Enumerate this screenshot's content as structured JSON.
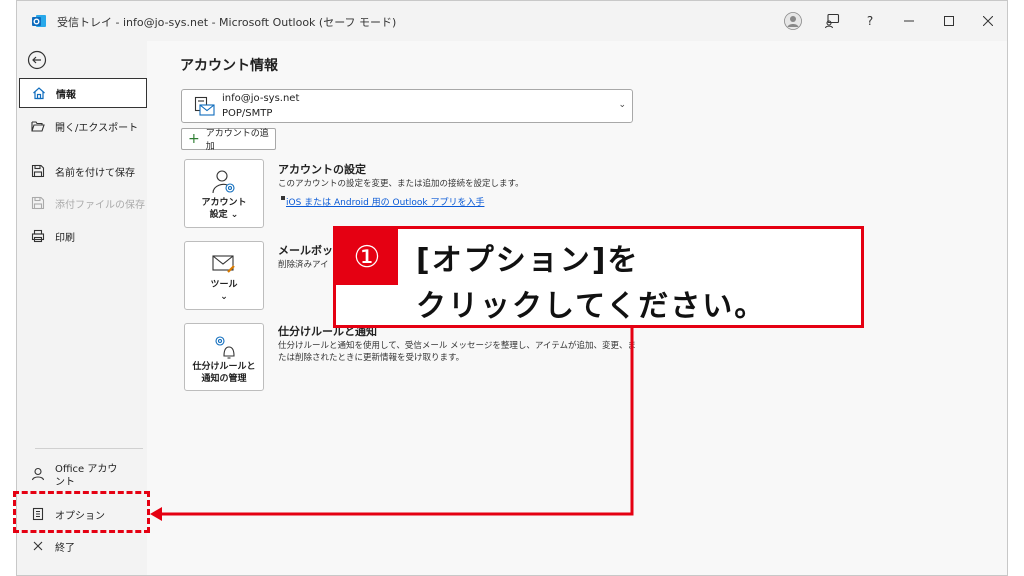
{
  "titlebar": {
    "title": "受信トレイ - info@jo-sys.net - Microsoft Outlook (セーフ モード)",
    "help_label": "?"
  },
  "sidebar": {
    "items": [
      {
        "label": "情報",
        "icon": "home-icon",
        "state": "active"
      },
      {
        "label": "開く/エクスポート",
        "icon": "folder-open-icon",
        "state": "normal"
      },
      {
        "label": "名前を付けて保存",
        "icon": "save-as-icon",
        "state": "normal"
      },
      {
        "label": "添付ファイルの保存",
        "icon": "save-attachment-icon",
        "state": "disabled"
      },
      {
        "label": "印刷",
        "icon": "printer-icon",
        "state": "normal"
      }
    ],
    "bottom_items": [
      {
        "label": "Office アカウント",
        "icon": "person-icon"
      },
      {
        "label": "オプション",
        "icon": "options-icon"
      },
      {
        "label": "終了",
        "icon": "close-icon"
      }
    ]
  },
  "main": {
    "page_title": "アカウント情報",
    "account": {
      "email": "info@jo-sys.net",
      "type": "POP/SMTP"
    },
    "add_account_label": "アカウントの追加",
    "sections": [
      {
        "button_label_line1": "アカウント",
        "button_label_line2": "設定 ⌄",
        "title": "アカウントの設定",
        "description": "このアカウントの設定を変更、または追加の接続を設定します。",
        "link": "iOS または Android 用の Outlook アプリを入手"
      },
      {
        "button_label_line1": "ツール",
        "button_label_line2": "⌄",
        "title": "メールボック",
        "description": "削除済みアイ"
      },
      {
        "button_label_line1": "仕分けルールと",
        "button_label_line2": "通知の管理",
        "title": "仕分けルールと通知",
        "description": "仕分けルールと通知を使用して、受信メール メッセージを整理し、アイテムが追加、変更、または削除されたときに更新情報を受け取ります。"
      }
    ]
  },
  "callout": {
    "number": "①",
    "line1": "[オプション]を",
    "line2": "クリックしてください。"
  },
  "colors": {
    "accent_red": "#e50012",
    "link_blue": "#0a5ad6",
    "outlook_blue": "#0f6cbd"
  }
}
